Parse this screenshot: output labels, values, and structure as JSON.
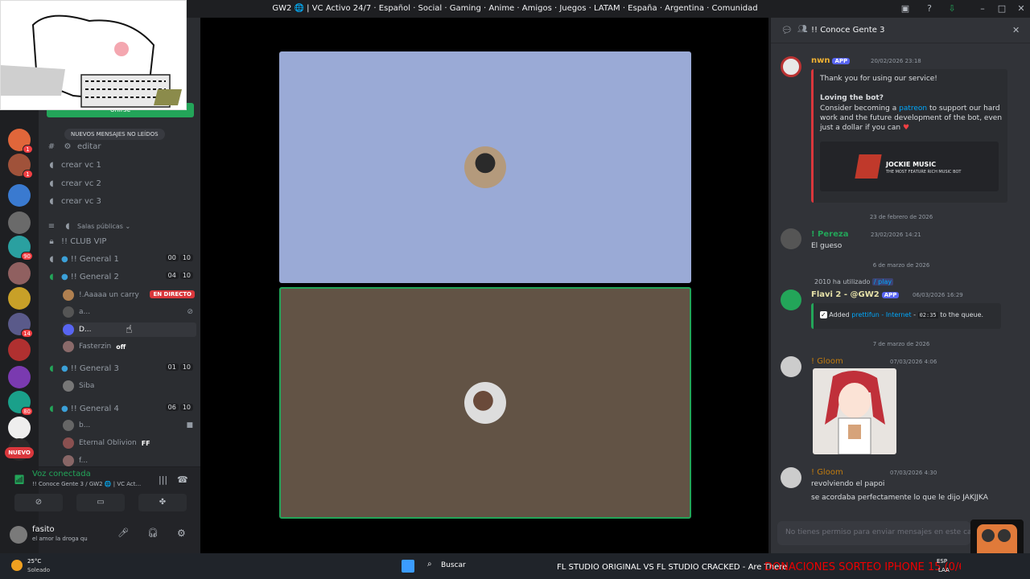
{
  "window": {
    "title": "GW2 🌐 | VC Activo 24/7 · Español · Social · Gaming · Anime · Amigos · Juegos · LATAM · España · Argentina · Comunidad"
  },
  "guilds": [
    {
      "badge": "1"
    },
    {
      "badge": "1"
    },
    {
      "badge": ""
    },
    {
      "badge": ""
    },
    {
      "badge": "90"
    },
    {
      "badge": ""
    },
    {
      "badge": ""
    },
    {
      "badge": "14"
    },
    {
      "badge": ""
    },
    {
      "badge": ""
    },
    {
      "badge": "80"
    },
    {
      "badge": ""
    },
    {
      "badge": ""
    }
  ],
  "guild_new_label": "NUEVO",
  "overlay_strip_label": "Unirse",
  "channels": {
    "new_messages_label": "NUEVOS MENSAJES NO LEÍDOS",
    "edit_label": "editar",
    "voice_creators": [
      "crear vc 1",
      "crear vc 2",
      "crear vc 3"
    ],
    "category_label": "Salas públicas",
    "vip_label": "!! CLUB VIP",
    "general1": {
      "label": "!! General 1",
      "count": "00",
      "limit": "10"
    },
    "general2": {
      "label": "!! General 2",
      "count": "04",
      "limit": "10"
    },
    "general2_users": [
      {
        "name": "!.Aaaaa un carry",
        "tag": "EN DIRECTO"
      },
      {
        "name": "a...",
        "tag": ""
      },
      {
        "name": "D...",
        "tag": ""
      },
      {
        "name": "Fasterzin",
        "tag": "off"
      }
    ],
    "general3": {
      "label": "!! General 3",
      "count": "01",
      "limit": "10"
    },
    "general3_users": [
      {
        "name": "Siba"
      }
    ],
    "general4": {
      "label": "!! General 4",
      "count": "06",
      "limit": "10"
    },
    "general4_users": [
      {
        "name": "b..."
      },
      {
        "name": "Eternal Oblivion",
        "tag": "FF"
      },
      {
        "name": "f..."
      }
    ]
  },
  "voice": {
    "status": "Voz conectada",
    "channel": "!! Conoce Gente 3 / GW2 🌐 | VC Act..."
  },
  "user": {
    "name": "fasito",
    "status": "el amor la droga qu"
  },
  "chat": {
    "title": "!! Conoce Gente 3",
    "input_placeholder": "No tienes permiso para enviar mensajes en este ca",
    "messages": [
      {
        "author": "nwn",
        "app": "APP",
        "time": "20/02/2026 23:18",
        "text1": "Thank you for using our service!",
        "heading": "Loving the bot?",
        "text2": "Consider becoming a ",
        "link": "patreon",
        "text3": " to support our hard work and the future development of the bot, even just a dollar if you can",
        "banner_title": "JOCKIE MUSIC",
        "banner_sub": "THE MOST FEATURE RICH MUSIC BOT"
      },
      {
        "divider": "23 de febrero de 2026"
      },
      {
        "author": "! Pereza",
        "time": "23/02/2026 14:21",
        "text": "El gueso"
      },
      {
        "divider": "6 de marzo de 2026"
      },
      {
        "reply": "2010 ha utilizado",
        "reply_cmd": "/ play",
        "author": "Flavi 2 - @GW2",
        "app": "APP",
        "time": "06/03/2026 16:29",
        "added_prefix": "Added ",
        "track": "prettifun - Internet",
        "duration": "02:35",
        "added_suffix": " to the queue."
      },
      {
        "divider": "7 de marzo de 2026"
      },
      {
        "author": "! Gloom",
        "time": "07/03/2026 4:06"
      },
      {
        "author": "! Gloom",
        "time": "07/03/2026 4:30",
        "text": "revolviendo el papoi",
        "text2": "se acordaba perfectamente lo que le dijo JAKJJKA"
      }
    ]
  },
  "taskbar": {
    "weather": "25°C",
    "weather_sub": "Soleado",
    "search_label": "Buscar",
    "ticker": "FL STUDIO ORIGINAL VS FL STUDIO CRACKED - Are There",
    "promo": "DONACIONES SORTEO IPHONE 15 (0/6)",
    "lang": "ESP",
    "lang_sub": "LAA"
  },
  "colors": {
    "accent": "#23a559",
    "danger": "#da373c",
    "blurple": "#5865f2",
    "link": "#00a8fc"
  }
}
